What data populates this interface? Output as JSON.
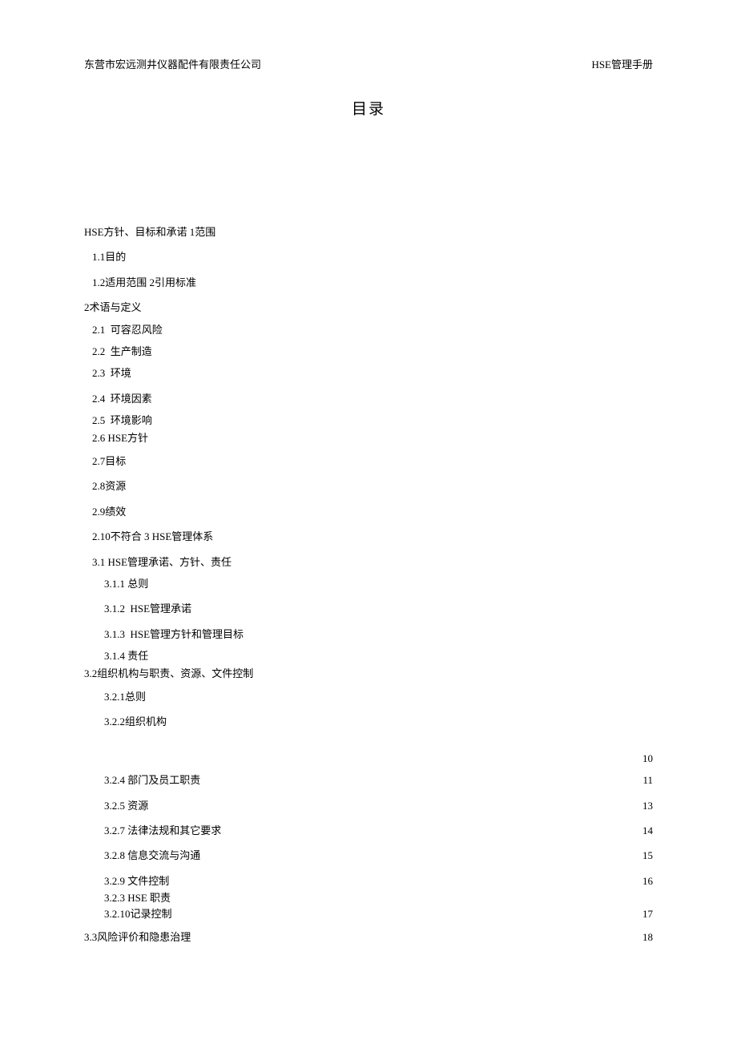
{
  "header": {
    "company": "东营市宏远测井仪器配件有限责任公司",
    "manual": "HSE管理手册"
  },
  "title": "目录",
  "toc": {
    "l1": "HSE方针、目标和承诺 1范围",
    "l2": "1.1目的",
    "l3": "1.2适用范围 2引用标准",
    "l4": "2术语与定义",
    "l5": "2.1  可容忍风险",
    "l6": "2.2  生产制造",
    "l7": "2.3  环境",
    "l8": "2.4  环境因素",
    "l9": "2.5  环境影响",
    "l10": "2.6 HSE方针",
    "l11": "2.7目标",
    "l12": "2.8资源",
    "l13": "2.9绩效",
    "l14": "2.10不符合 3 HSE管理体系",
    "l15": "3.1 HSE管理承诺、方针、责任",
    "l16": "3.1.1 总则",
    "l17": "3.1.2  HSE管理承诺",
    "l18": "3.1.3  HSE管理方针和管理目标",
    "l19": "3.1.4 责任",
    "l20": "3.2组织机构与职责、资源、文件控制",
    "l21": "3.2.1总则",
    "l22": "3.2.2组织机构",
    "l23": "3.2.4 部门及员工职责",
    "l24": "3.2.5 资源",
    "l25": "3.2.7 法律法规和其它要求",
    "l26": "3.2.8 信息交流与沟通",
    "l27": "3.2.9 文件控制",
    "l28": "3.2.3 HSE 职责",
    "l29": "3.2.10记录控制",
    "l30": "3.3风险评价和隐患治理",
    "p_blank": "10",
    "p23": "11",
    "p24": "13",
    "p25": "14",
    "p26": "15",
    "p27": "16",
    "p29": "17",
    "p30": "18"
  }
}
